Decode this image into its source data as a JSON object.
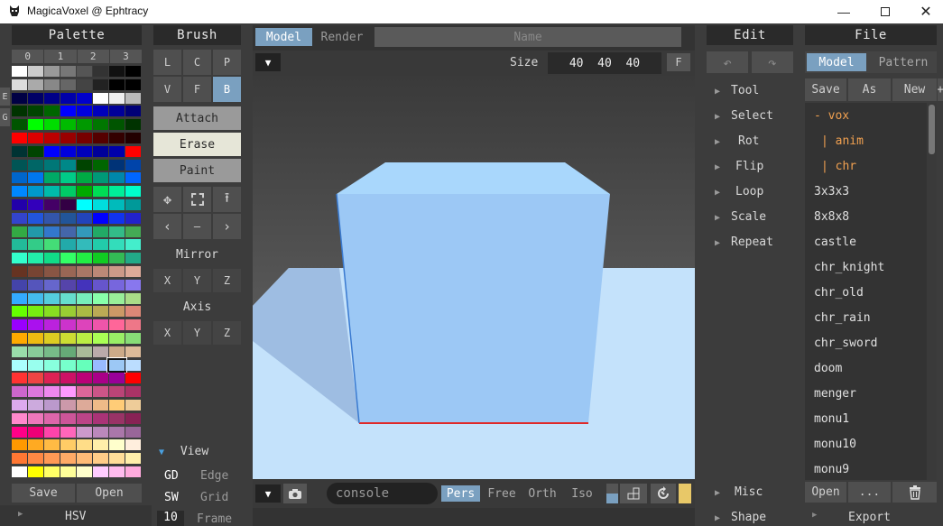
{
  "window": {
    "title": "MagicaVoxel @ Ephtracy",
    "controls": [
      "minimize",
      "maximize",
      "close"
    ]
  },
  "palette": {
    "title": "Palette",
    "tabs": [
      "0",
      "1",
      "2",
      "3"
    ],
    "side_tabs": [
      "E",
      "G"
    ],
    "rows": [
      [
        "#ffffff",
        "#cccccc",
        "#999999",
        "#777777",
        "#555555",
        "#333333",
        "#111111",
        "#000000"
      ],
      [
        "#dddddd",
        "#aaaaaa",
        "#888888",
        "#666666",
        "#444444",
        "#222222",
        "#000000",
        "#000000"
      ],
      [
        "#000044",
        "#000066",
        "#000088",
        "#0000aa",
        "#0000cc",
        "#ffffff",
        "#eeeeee",
        "#bbbbbb"
      ],
      [
        "#003300",
        "#004400",
        "#006600",
        "#0000ff",
        "#0000dd",
        "#0000bb",
        "#000099",
        "#000077"
      ],
      [
        "#005500",
        "#00ff00",
        "#00dd00",
        "#00bb00",
        "#009900",
        "#007700",
        "#005500",
        "#003300"
      ],
      [
        "#ff0000",
        "#dd0000",
        "#bb0000",
        "#990000",
        "#770000",
        "#550000",
        "#330000",
        "#220000"
      ],
      [
        "#003333",
        "#004400",
        "#0000ff",
        "#0000dd",
        "#0000bb",
        "#000099",
        "#0000aa",
        "#ff0000"
      ],
      [
        "#005555",
        "#006666",
        "#007777",
        "#008888",
        "#004400",
        "#006600",
        "#003377",
        "#0044aa"
      ],
      [
        "#0066cc",
        "#0077ee",
        "#00aa66",
        "#00cc88",
        "#00aa44",
        "#009977",
        "#0088aa",
        "#0066ff"
      ],
      [
        "#0088ff",
        "#0099cc",
        "#00bbaa",
        "#00cc66",
        "#00aa00",
        "#00dd55",
        "#00ee99",
        "#00ffcc"
      ],
      [
        "#2200aa",
        "#3300bb",
        "#440066",
        "#330044",
        "#00ffff",
        "#00dddd",
        "#00bbbb",
        "#009999"
      ],
      [
        "#3344cc",
        "#2255dd",
        "#3355aa",
        "#225599",
        "#2244bb",
        "#0000ff",
        "#1133ee",
        "#2222cc"
      ],
      [
        "#33aa44",
        "#2299aa",
        "#3377cc",
        "#4466aa",
        "#3399bb",
        "#22aa66",
        "#33bb88",
        "#44aa55"
      ],
      [
        "#22bb99",
        "#33cc88",
        "#44dd77",
        "#22aaaa",
        "#33bbbb",
        "#22ccaa",
        "#33ddbb",
        "#44eecc"
      ],
      [
        "#33ffcc",
        "#22eeaa",
        "#11dd88",
        "#33ff66",
        "#22ee44",
        "#11cc22",
        "#33bb55",
        "#22aa88"
      ],
      [
        "#663322",
        "#774433",
        "#885544",
        "#996655",
        "#aa7766",
        "#bb8877",
        "#cc9988",
        "#ddaa99"
      ],
      [
        "#4444aa",
        "#5555bb",
        "#6666cc",
        "#5544aa",
        "#4433bb",
        "#6655cc",
        "#7766dd",
        "#8877ee"
      ],
      [
        "#33aaff",
        "#44bbee",
        "#55ccdd",
        "#66ddcc",
        "#77eebb",
        "#88ffaa",
        "#99ee99",
        "#aadd88"
      ],
      [
        "#66ff00",
        "#77ee11",
        "#88dd22",
        "#99cc33",
        "#aabb44",
        "#bbaa55",
        "#cc9966",
        "#dd8877"
      ],
      [
        "#9900ff",
        "#aa11ee",
        "#bb22dd",
        "#cc33cc",
        "#dd44bb",
        "#ee55aa",
        "#ff6699",
        "#ee7788"
      ],
      [
        "#ffaa00",
        "#eebb11",
        "#ddcc22",
        "#ccdd33",
        "#bbee44",
        "#aaff55",
        "#99ee66",
        "#88dd77"
      ],
      [
        "#99ddaa",
        "#88cc99",
        "#77bb88",
        "#66aa77",
        "#aabb99",
        "#bbaaaa",
        "#ccaa88",
        "#ddbb99"
      ],
      [
        "#aaffff",
        "#99ffee",
        "#88ffdd",
        "#77ffcc",
        "#66ffbb",
        "#99bbff",
        "#aaccff",
        "#bbddff"
      ],
      [
        "#ff3333",
        "#ee4444",
        "#dd2255",
        "#cc1166",
        "#bb0077",
        "#aa0088",
        "#990099",
        "#ff0000"
      ],
      [
        "#cc66cc",
        "#dd77dd",
        "#ee88ee",
        "#ff99ff",
        "#dd6699",
        "#cc5588",
        "#bb4477",
        "#aa3366"
      ],
      [
        "#ddaaee",
        "#ccaadd",
        "#bb99cc",
        "#cc99aa",
        "#ddaa99",
        "#eebb88",
        "#ffcc77",
        "#eecc99"
      ],
      [
        "#ff88cc",
        "#ee77bb",
        "#dd66aa",
        "#cc5599",
        "#bb4488",
        "#aa3377",
        "#993366",
        "#882255"
      ],
      [
        "#ff0088",
        "#ee0077",
        "#ff44aa",
        "#ff66bb",
        "#cc99cc",
        "#bb88bb",
        "#aa77aa",
        "#996699"
      ],
      [
        "#ff9900",
        "#ffaa22",
        "#ffbb44",
        "#ffcc66",
        "#ffdd88",
        "#ffeeaa",
        "#ffffcc",
        "#ffeedd"
      ],
      [
        "#ff7733",
        "#ff8844",
        "#ff9955",
        "#ffaa66",
        "#ffbb77",
        "#ffcc88",
        "#ffdd99",
        "#ffeeaa"
      ],
      [
        "#ffffff",
        "#ffff00",
        "#ffff66",
        "#ffff99",
        "#ffffcc",
        "#ffccff",
        "#ffbbee",
        "#ffaadd"
      ]
    ],
    "selected": {
      "row": 22,
      "col": 6,
      "color": "#9cc8f5"
    },
    "save_label": "Save",
    "open_label": "Open",
    "hsv_label": "HSV"
  },
  "brush": {
    "title": "Brush",
    "row1": [
      "L",
      "C",
      "P"
    ],
    "row2": [
      "V",
      "F",
      "B"
    ],
    "modes": [
      "Attach",
      "Erase",
      "Paint"
    ],
    "active_mode": "Erase",
    "mirror_label": "Mirror",
    "axis_label": "Axis",
    "xyz": [
      "X",
      "Y",
      "Z"
    ]
  },
  "view": {
    "label": "View",
    "rows": [
      {
        "key": "GD",
        "label": "Edge"
      },
      {
        "key": "SW",
        "label": "Grid"
      },
      {
        "key": "10",
        "label": "Frame"
      }
    ]
  },
  "viewport": {
    "tabs": [
      "Model",
      "Render"
    ],
    "active_tab": "Model",
    "name_placeholder": "Name",
    "size_label": "Size",
    "size_value": "40  40  40",
    "f_label": "F",
    "console_placeholder": "console",
    "cameras": [
      "Pers",
      "Free",
      "Orth",
      "Iso"
    ],
    "active_camera": "Pers"
  },
  "edit": {
    "title": "Edit",
    "items": [
      "Tool",
      "Select",
      "Rot",
      "Flip",
      "Loop",
      "Scale",
      "Repeat"
    ],
    "bottom": [
      "Misc",
      "Shape"
    ]
  },
  "file": {
    "title": "File",
    "tabs": [
      "Model",
      "Pattern"
    ],
    "active_tab": "Model",
    "actions": [
      "Save",
      "As",
      "New",
      "+"
    ],
    "items": [
      {
        "label": "- vox",
        "type": "folder"
      },
      {
        "label": "| anim",
        "type": "folder"
      },
      {
        "label": "| chr",
        "type": "folder"
      },
      {
        "label": "3x3x3"
      },
      {
        "label": "8x8x8"
      },
      {
        "label": "castle"
      },
      {
        "label": "chr_knight"
      },
      {
        "label": "chr_old"
      },
      {
        "label": "chr_rain"
      },
      {
        "label": "chr_sword"
      },
      {
        "label": "doom"
      },
      {
        "label": "menger"
      },
      {
        "label": "monu1"
      },
      {
        "label": "monu10"
      },
      {
        "label": "monu9"
      }
    ],
    "open_label": "Open",
    "more_label": "...",
    "export_label": "Export"
  }
}
